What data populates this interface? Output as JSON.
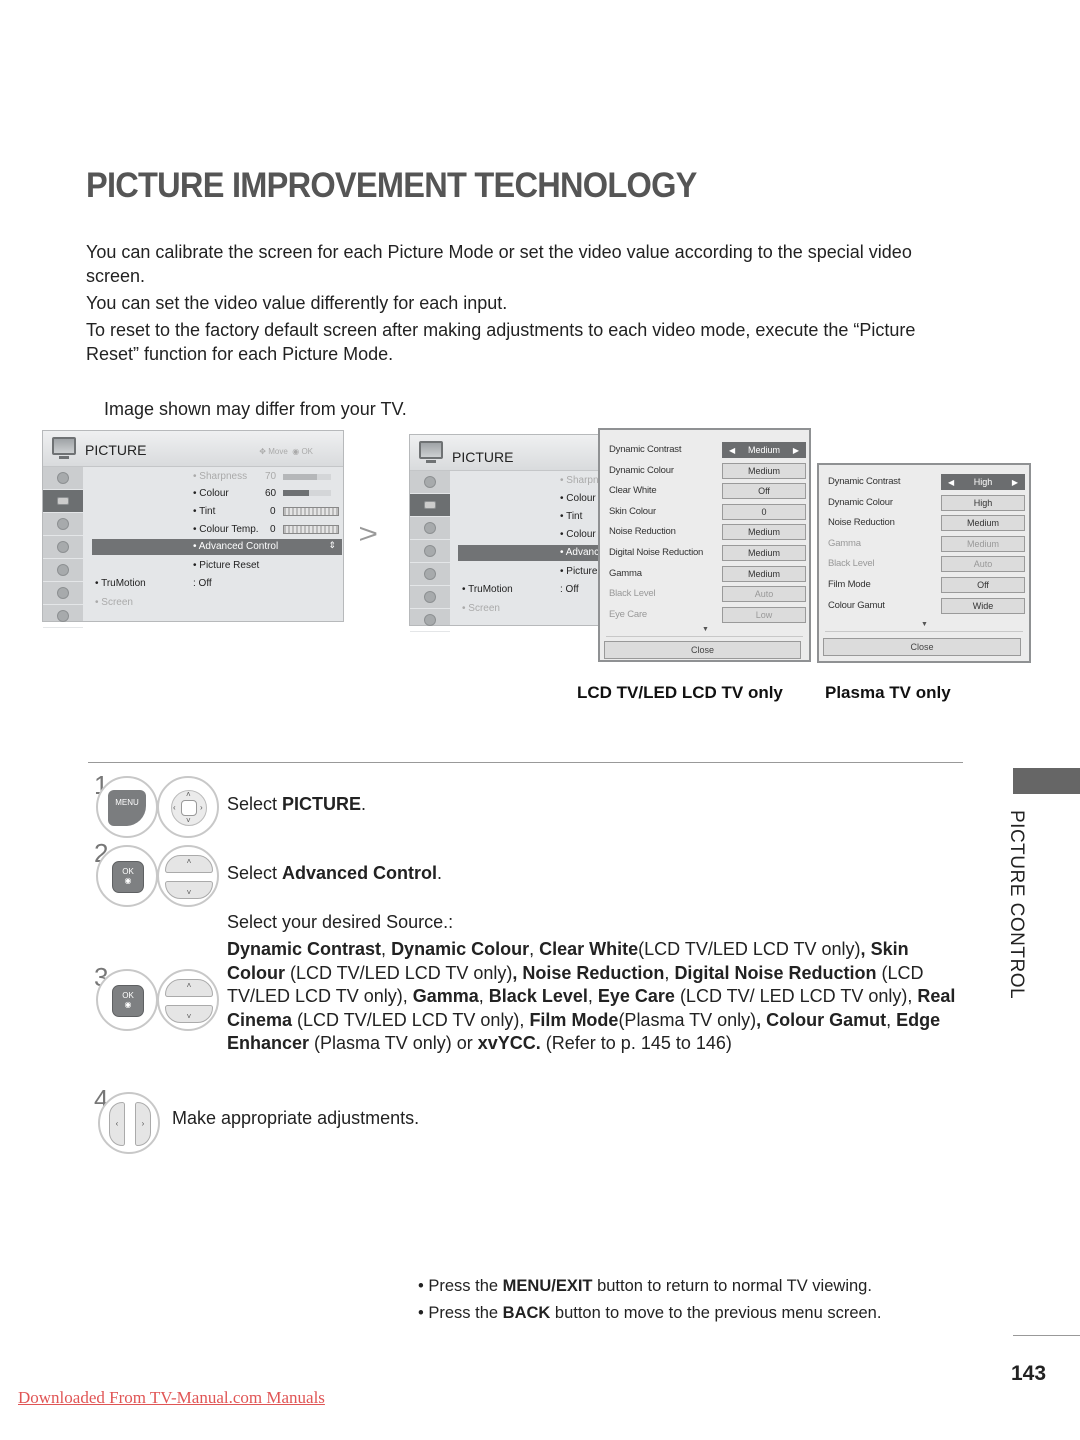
{
  "page": {
    "title": "PICTURE IMPROVEMENT TECHNOLOGY",
    "intro": [
      "You can calibrate the screen for each Picture Mode or set the video value according to the special video screen.",
      "You can set the video value differently for each input.",
      "To reset to the factory default screen after making adjustments to each video mode, execute the “Picture Reset” function for each Picture Mode."
    ],
    "note": "Image shown may differ from your TV.",
    "page_number": "143",
    "side_label": "PICTURE CONTROL",
    "footer_link": "Downloaded From TV-Manual.com Manuals"
  },
  "tv_menu": {
    "title": "PICTURE",
    "hint_move": "Move",
    "hint_ok": "OK",
    "sidebar_icons": [
      "picture-mode-icon",
      "picture-icon",
      "audio-icon",
      "time-icon",
      "lock-icon",
      "option-icon",
      "network-icon"
    ],
    "items": [
      {
        "label": "• Sharpness",
        "value": "70",
        "bar": 0.7,
        "dim": true
      },
      {
        "label": "• Colour",
        "value": "60",
        "bar": 0.6
      },
      {
        "label": "• Tint",
        "value": "0",
        "slider_left": "R",
        "slider_right": "G"
      },
      {
        "label": "• Colour Temp.",
        "value": "0",
        "slider_left": "W",
        "slider_right": "C"
      },
      {
        "label": "• Advanced Control",
        "selected": true
      },
      {
        "label": "• Picture Reset"
      }
    ],
    "left_items": [
      {
        "label": "• TruMotion",
        "value": ": Off"
      },
      {
        "label": "• Screen",
        "dim": true
      }
    ]
  },
  "tv_menu_2": {
    "title": "PICTURE",
    "items": [
      "• Sharpn",
      "• Colour",
      "• Tint",
      "• Colour",
      "• Advanc",
      "• Picture"
    ],
    "left_items": [
      {
        "label": "• TruMotion",
        "value": ": Off"
      },
      {
        "label": "• Screen"
      }
    ]
  },
  "lcd_popup": {
    "caption": "LCD TV/LED LCD TV only",
    "rows": [
      {
        "label": "Dynamic Contrast",
        "value": "Medium",
        "selected": true
      },
      {
        "label": "Dynamic Colour",
        "value": "Medium"
      },
      {
        "label": "Clear White",
        "value": "Off"
      },
      {
        "label": "Skin Colour",
        "value": "0"
      },
      {
        "label": "Noise Reduction",
        "value": "Medium"
      },
      {
        "label": "Digital Noise Reduction",
        "value": "Medium"
      },
      {
        "label": "Gamma",
        "value": "Medium"
      },
      {
        "label": "Black Level",
        "value": "Auto",
        "dim": true
      },
      {
        "label": "Eye Care",
        "value": "Low",
        "dim": true
      }
    ],
    "close_label": "Close"
  },
  "plasma_popup": {
    "caption": "Plasma TV only",
    "rows": [
      {
        "label": "Dynamic Contrast",
        "value": "High",
        "selected": true
      },
      {
        "label": "Dynamic Colour",
        "value": "High"
      },
      {
        "label": "Noise Reduction",
        "value": "Medium"
      },
      {
        "label": "Gamma",
        "value": "Medium",
        "dim": true
      },
      {
        "label": "Black Level",
        "value": "Auto",
        "dim": true
      },
      {
        "label": "Film Mode",
        "value": "Off"
      },
      {
        "label": "Colour Gamut",
        "value": "Wide"
      }
    ],
    "close_label": "Close"
  },
  "steps": [
    {
      "number": "1",
      "keys": [
        "MENU"
      ],
      "text_pre": "Select ",
      "text_bold": "PICTURE",
      "text_post": "."
    },
    {
      "number": "2",
      "keys": [
        "OK"
      ],
      "text_pre": "Select ",
      "text_bold": "Advanced Control",
      "text_post": "."
    },
    {
      "number": "3",
      "keys": [
        "OK"
      ],
      "intro": "Select your desired Source.:"
    },
    {
      "number": "4",
      "text": "Make appropriate adjustments."
    }
  ],
  "step3_segments": [
    {
      "b": "Dynamic Contrast"
    },
    {
      "t": ",  "
    },
    {
      "b": "Dynamic Colour"
    },
    {
      "t": ", "
    },
    {
      "b": "Clear White"
    },
    {
      "t": "(LCD TV/LED LCD TV only)"
    },
    {
      "b": ","
    },
    {
      "t": " "
    },
    {
      "b": "Skin Colour"
    },
    {
      "t": " (LCD TV/LED LCD TV only)"
    },
    {
      "b": ", Noise Reduction"
    },
    {
      "t": ", "
    },
    {
      "b": "Digital Noise Reduction"
    },
    {
      "t": " (LCD TV/LED LCD TV only), "
    },
    {
      "b": "Gamma"
    },
    {
      "t": ", "
    },
    {
      "b": "Black Level"
    },
    {
      "t": ", "
    },
    {
      "b": "Eye Care"
    },
    {
      "t": " (LCD TV/ LED LCD TV only), "
    },
    {
      "b": "Real Cinema"
    },
    {
      "t": " (LCD TV/LED LCD TV only), "
    },
    {
      "b": "Film Mode"
    },
    {
      "t": "(Plasma TV only)"
    },
    {
      "b": ", Colour Gamut"
    },
    {
      "t": ", "
    },
    {
      "b": "Edge Enhancer"
    },
    {
      "t": " (Plasma TV only) or "
    },
    {
      "b": "xvYCC."
    },
    {
      "t": " (Refer to p. 145 to 146)"
    }
  ],
  "tips": [
    {
      "pre": "• Press the ",
      "bold": "MENU/EXIT",
      "post": " button to return to normal TV viewing."
    },
    {
      "pre": "• Press the ",
      "bold": "BACK",
      "post": " button to move to the previous menu screen."
    }
  ]
}
